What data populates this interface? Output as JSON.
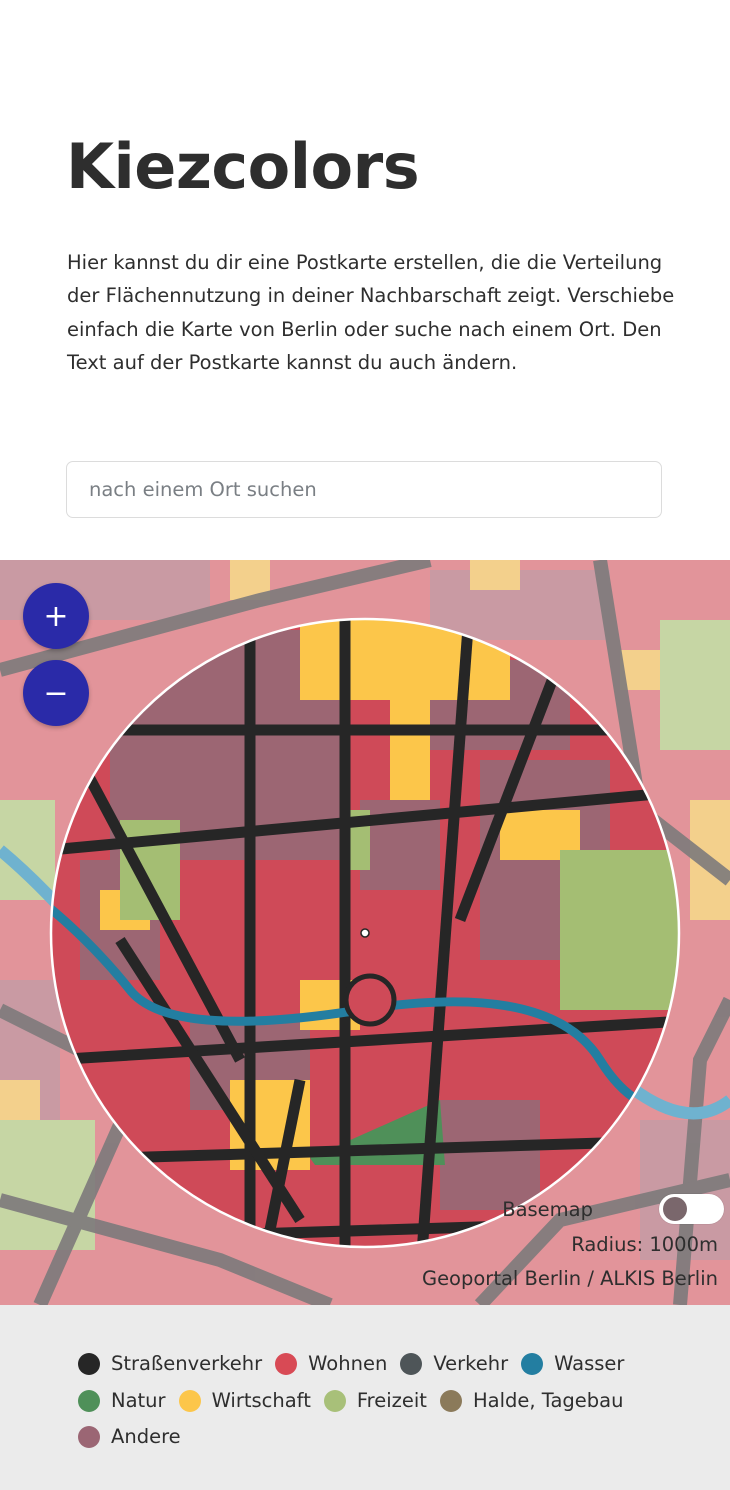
{
  "header": {
    "title": "Kiezcolors",
    "intro": "Hier kannst du dir eine Postkarte erstellen, die die Verteilung der Flächennutzung in deiner Nachbarschaft zeigt. Verschiebe einfach die Karte von Berlin oder suche nach einem Ort. Den Text auf der Postkarte kannst du auch ändern."
  },
  "search": {
    "placeholder": "nach einem Ort suchen",
    "value": ""
  },
  "map": {
    "zoom_in_label": "+",
    "zoom_out_label": "−",
    "basemap_label": "Basemap",
    "basemap_enabled": false,
    "radius_text": "Radius: 1000m",
    "attribution": "Geoportal Berlin / ALKIS Berlin"
  },
  "legend": {
    "items": [
      {
        "label": "Straßenverkehr",
        "color": "#262626"
      },
      {
        "label": "Wohnen",
        "color": "#d84a55"
      },
      {
        "label": "Verkehr",
        "color": "#4e5558"
      },
      {
        "label": "Wasser",
        "color": "#237ea1"
      },
      {
        "label": "Natur",
        "color": "#4f9059"
      },
      {
        "label": "Wirtschaft",
        "color": "#fcc64a"
      },
      {
        "label": "Freizeit",
        "color": "#a8c079"
      },
      {
        "label": "Halde, Tagebau",
        "color": "#8b7a5a"
      },
      {
        "label": "Andere",
        "color": "#9b6674"
      }
    ]
  }
}
